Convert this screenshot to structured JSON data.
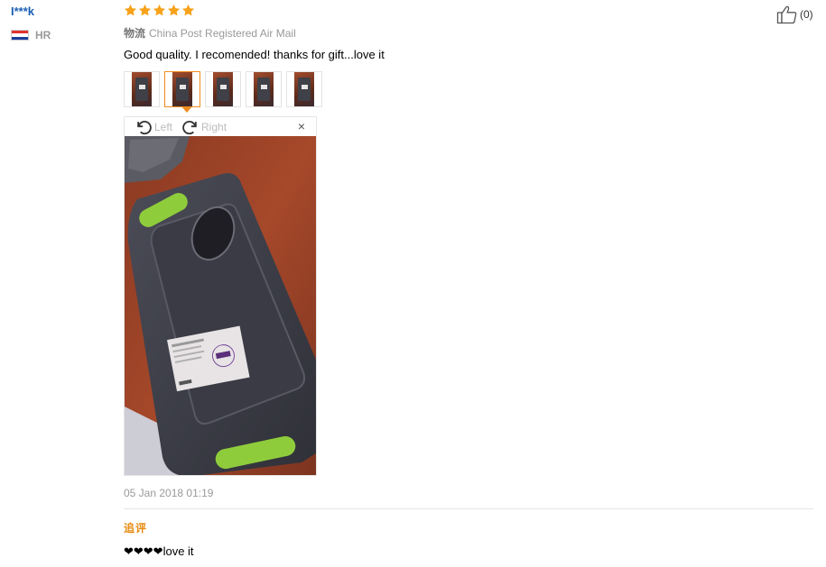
{
  "reviewer": {
    "name": "I***k",
    "country_code": "HR",
    "flag_colors": [
      "#e0332e",
      "#ffffff",
      "#1d3f9c"
    ]
  },
  "rating": {
    "stars": 5,
    "max": 5,
    "star_color": "#f7a21b"
  },
  "logistics": {
    "label": "物流",
    "value": "China Post Registered Air Mail"
  },
  "review_text": "Good quality. I recomended! thanks for gift...love it",
  "thumbnails": {
    "count": 5,
    "selected_index": 1,
    "items": [
      "thumbnail-1",
      "thumbnail-2",
      "thumbnail-3",
      "thumbnail-4",
      "thumbnail-5"
    ]
  },
  "viewer": {
    "rotate_left_label": "Left",
    "rotate_right_label": "Right",
    "close_label": "×"
  },
  "date": "05 Jan 2018 01:19",
  "followup": {
    "label": "追评",
    "text": "❤❤❤❤love it"
  },
  "helpful": {
    "count_label": "(0)",
    "icon": "thumbs-up-icon"
  },
  "accent_colors": {
    "link": "#1a5fb4",
    "highlight": "#f08c1e",
    "followup": "#e6890c"
  }
}
